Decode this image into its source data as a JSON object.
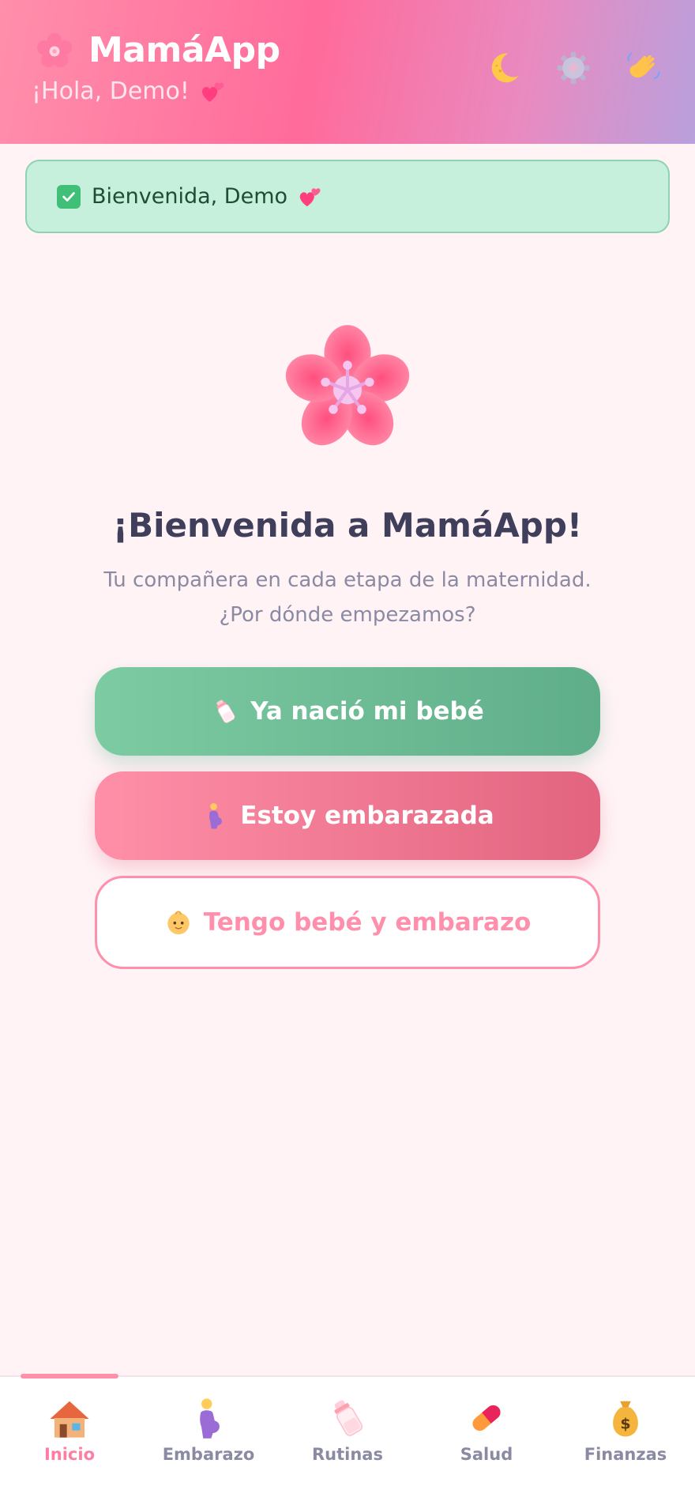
{
  "header": {
    "app_name": "MamáApp",
    "greeting": "¡Hola, Demo!",
    "logo_icon": "cherry-blossom-icon",
    "actions": [
      {
        "icon": "moon-icon"
      },
      {
        "icon": "gear-icon"
      },
      {
        "icon": "waving-hand-icon"
      }
    ]
  },
  "toast": {
    "icon": "check-icon",
    "text": "Bienvenida, Demo"
  },
  "hero": {
    "icon": "cherry-blossom-icon",
    "title": "¡Bienvenida a MamáApp!",
    "subtitle_line1": "Tu compañera en cada etapa de la maternidad.",
    "subtitle_line2": "¿Por dónde empezamos?"
  },
  "options": {
    "born": {
      "label": "Ya nació mi bebé",
      "icon": "baby-bottle-icon"
    },
    "pregnant": {
      "label": "Estoy embarazada",
      "icon": "pregnant-woman-icon"
    },
    "both": {
      "label": "Tengo bebé y embarazo",
      "icon": "baby-face-icon"
    }
  },
  "nav": {
    "active": "Inicio",
    "items": [
      {
        "label": "Inicio",
        "icon": "house-icon"
      },
      {
        "label": "Embarazo",
        "icon": "pregnant-woman-icon"
      },
      {
        "label": "Rutinas",
        "icon": "baby-bottle-icon"
      },
      {
        "label": "Salud",
        "icon": "pill-icon"
      },
      {
        "label": "Finanzas",
        "icon": "money-bag-icon"
      }
    ]
  },
  "colors": {
    "primary_pink": "#ff8fab",
    "green": "#6fbd94",
    "background": "#fff3f6",
    "text_dark": "#3f3f5c"
  }
}
